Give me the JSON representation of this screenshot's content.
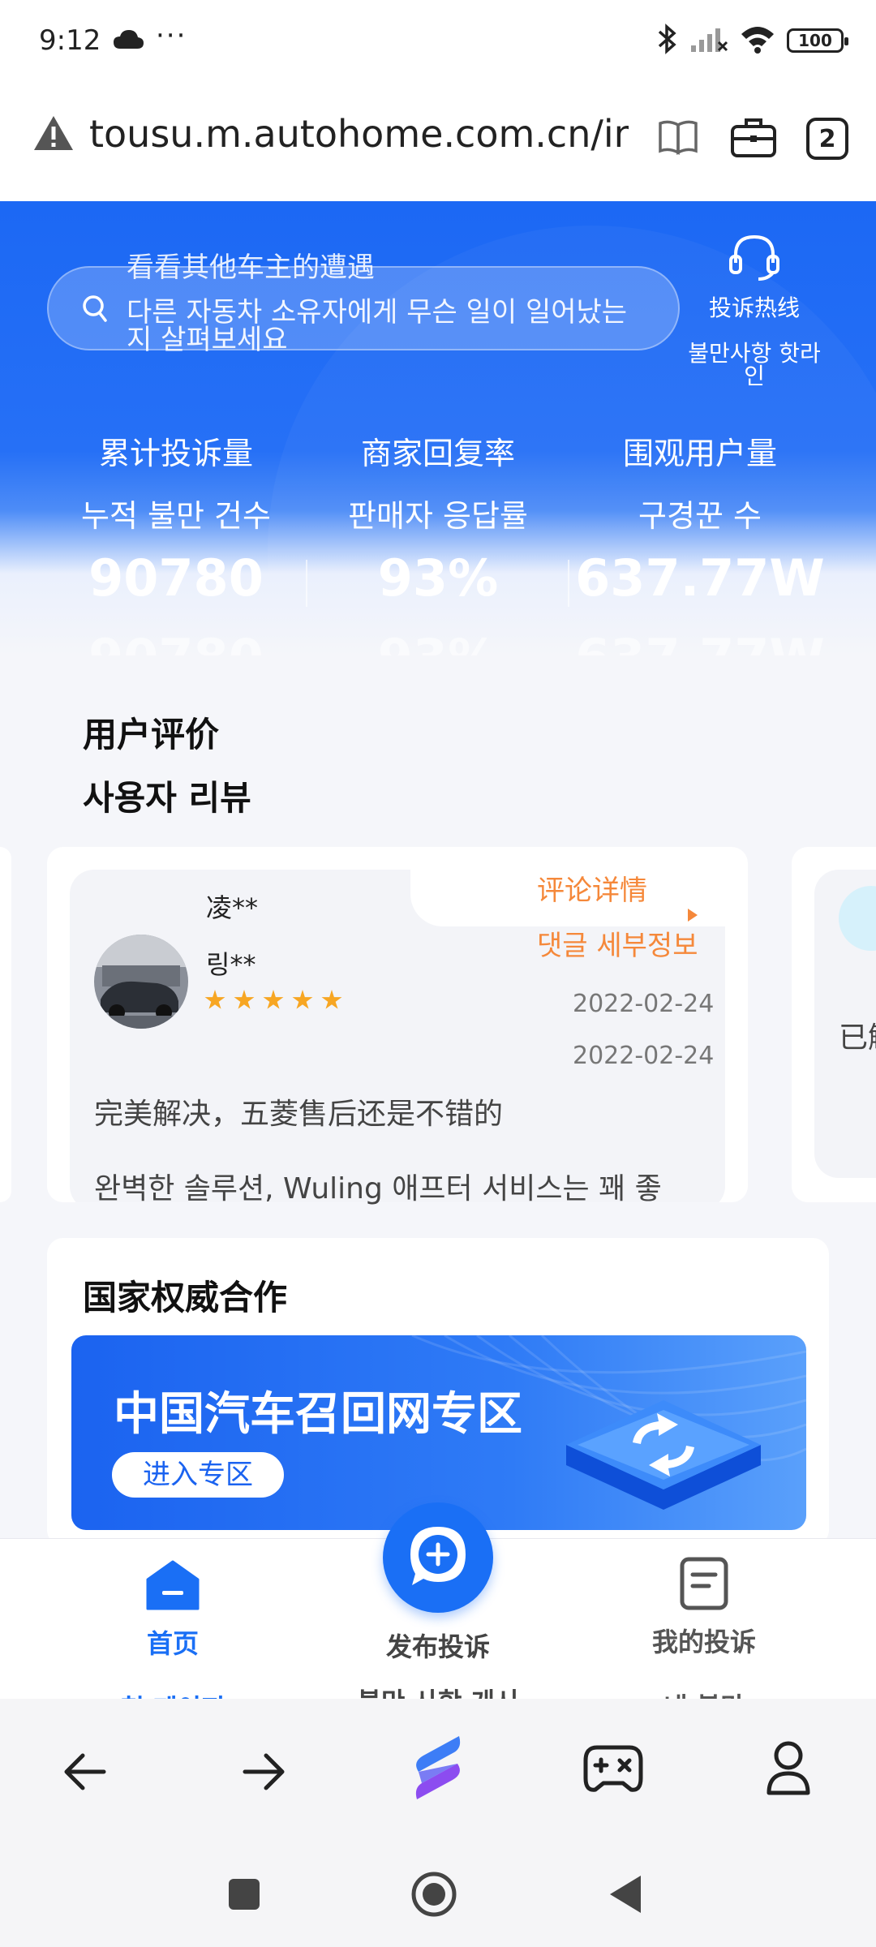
{
  "status_bar": {
    "time": "9:12",
    "dots": "···",
    "battery": "100"
  },
  "url_bar": {
    "url": "tousu.m.autohome.com.cn/index",
    "tab_count": "2"
  },
  "search": {
    "placeholder_cn": "看看其他车主的遭遇",
    "placeholder_kr": "다른 자동차 소유자에게 무슨 일이 일어났는지 살펴보세요"
  },
  "hotline": {
    "label_cn": "投诉热线",
    "label_kr": "불만사항 핫라인"
  },
  "stats": [
    {
      "label_cn": "累计投诉量",
      "label_kr": "누적 불만 건수",
      "value": "90780"
    },
    {
      "label_cn": "商家回复率",
      "label_kr": "판매자 응답률",
      "value": "93%"
    },
    {
      "label_cn": "围观用户量",
      "label_kr": "구경꾼 수",
      "value": "637.77W"
    }
  ],
  "reviews": {
    "title_cn": "用户评价",
    "title_kr": "사용자 리뷰",
    "detail_cn": "评论详情",
    "detail_kr": "댓글 세부정보",
    "item": {
      "name_cn": "凌**",
      "name_kr": "링**",
      "rating": 5,
      "date_1": "2022-02-24",
      "date_2": "2022-02-24",
      "text_cn": "完美解决，五菱售后还是不错的",
      "text_kr": "완벽한 솔루션, Wuling 애프터 서비스는 꽤 좋"
    },
    "next_item_text": "已解"
  },
  "partner": {
    "title": "国家权威合作",
    "banner_title": "中国汽车召回网专区",
    "banner_button": "进入专区"
  },
  "tabbar": {
    "home_cn": "首页",
    "home_kr": "첫 페이지",
    "publish_cn": "发布投诉",
    "publish_kr": "불만 사항 게시",
    "mine_cn": "我的投诉",
    "mine_kr": "내 불만"
  },
  "colors": {
    "brand_blue": "#1a6ff5",
    "accent_orange": "#f5883a",
    "star_yellow": "#f7a623"
  }
}
